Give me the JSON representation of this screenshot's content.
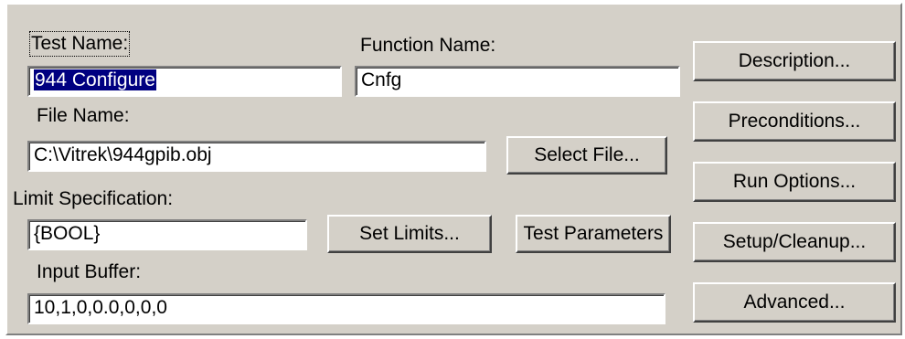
{
  "labels": {
    "test_name": "Test Name:",
    "function_name": "Function Name:",
    "file_name": "File Name:",
    "limit_specification": "Limit Specification:",
    "input_buffer": "Input Buffer:"
  },
  "fields": {
    "test_name": "944 Configure",
    "function_name": "Cnfg",
    "file_name": "C:\\Vitrek\\944gpib.obj",
    "limit_specification": "{BOOL}",
    "input_buffer": "10,1,0,0.0,0,0,0"
  },
  "buttons": {
    "select_file": "Select File...",
    "set_limits": "Set Limits...",
    "test_parameters": "Test Parameters",
    "description": "Description...",
    "preconditions": "Preconditions...",
    "run_options": "Run Options...",
    "setup_cleanup": "Setup/Cleanup...",
    "advanced": "Advanced..."
  }
}
